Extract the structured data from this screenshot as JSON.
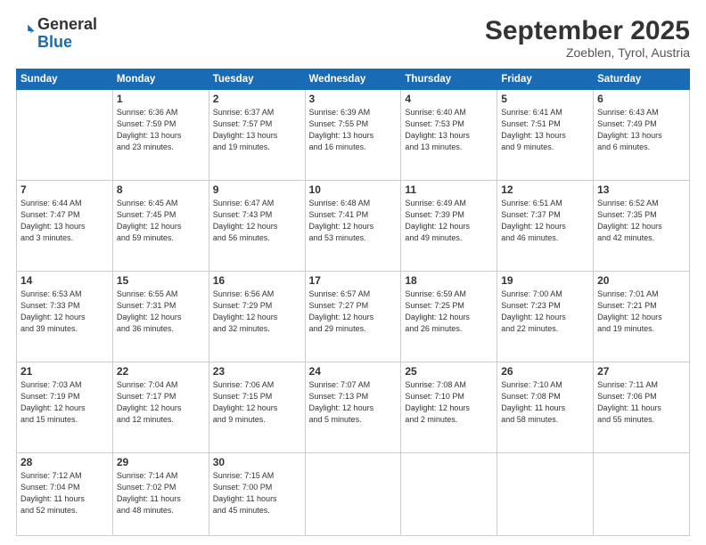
{
  "header": {
    "logo_general": "General",
    "logo_blue": "Blue",
    "month": "September 2025",
    "location": "Zoeblen, Tyrol, Austria"
  },
  "weekdays": [
    "Sunday",
    "Monday",
    "Tuesday",
    "Wednesday",
    "Thursday",
    "Friday",
    "Saturday"
  ],
  "weeks": [
    [
      {
        "day": "",
        "info": ""
      },
      {
        "day": "1",
        "info": "Sunrise: 6:36 AM\nSunset: 7:59 PM\nDaylight: 13 hours\nand 23 minutes."
      },
      {
        "day": "2",
        "info": "Sunrise: 6:37 AM\nSunset: 7:57 PM\nDaylight: 13 hours\nand 19 minutes."
      },
      {
        "day": "3",
        "info": "Sunrise: 6:39 AM\nSunset: 7:55 PM\nDaylight: 13 hours\nand 16 minutes."
      },
      {
        "day": "4",
        "info": "Sunrise: 6:40 AM\nSunset: 7:53 PM\nDaylight: 13 hours\nand 13 minutes."
      },
      {
        "day": "5",
        "info": "Sunrise: 6:41 AM\nSunset: 7:51 PM\nDaylight: 13 hours\nand 9 minutes."
      },
      {
        "day": "6",
        "info": "Sunrise: 6:43 AM\nSunset: 7:49 PM\nDaylight: 13 hours\nand 6 minutes."
      }
    ],
    [
      {
        "day": "7",
        "info": "Sunrise: 6:44 AM\nSunset: 7:47 PM\nDaylight: 13 hours\nand 3 minutes."
      },
      {
        "day": "8",
        "info": "Sunrise: 6:45 AM\nSunset: 7:45 PM\nDaylight: 12 hours\nand 59 minutes."
      },
      {
        "day": "9",
        "info": "Sunrise: 6:47 AM\nSunset: 7:43 PM\nDaylight: 12 hours\nand 56 minutes."
      },
      {
        "day": "10",
        "info": "Sunrise: 6:48 AM\nSunset: 7:41 PM\nDaylight: 12 hours\nand 53 minutes."
      },
      {
        "day": "11",
        "info": "Sunrise: 6:49 AM\nSunset: 7:39 PM\nDaylight: 12 hours\nand 49 minutes."
      },
      {
        "day": "12",
        "info": "Sunrise: 6:51 AM\nSunset: 7:37 PM\nDaylight: 12 hours\nand 46 minutes."
      },
      {
        "day": "13",
        "info": "Sunrise: 6:52 AM\nSunset: 7:35 PM\nDaylight: 12 hours\nand 42 minutes."
      }
    ],
    [
      {
        "day": "14",
        "info": "Sunrise: 6:53 AM\nSunset: 7:33 PM\nDaylight: 12 hours\nand 39 minutes."
      },
      {
        "day": "15",
        "info": "Sunrise: 6:55 AM\nSunset: 7:31 PM\nDaylight: 12 hours\nand 36 minutes."
      },
      {
        "day": "16",
        "info": "Sunrise: 6:56 AM\nSunset: 7:29 PM\nDaylight: 12 hours\nand 32 minutes."
      },
      {
        "day": "17",
        "info": "Sunrise: 6:57 AM\nSunset: 7:27 PM\nDaylight: 12 hours\nand 29 minutes."
      },
      {
        "day": "18",
        "info": "Sunrise: 6:59 AM\nSunset: 7:25 PM\nDaylight: 12 hours\nand 26 minutes."
      },
      {
        "day": "19",
        "info": "Sunrise: 7:00 AM\nSunset: 7:23 PM\nDaylight: 12 hours\nand 22 minutes."
      },
      {
        "day": "20",
        "info": "Sunrise: 7:01 AM\nSunset: 7:21 PM\nDaylight: 12 hours\nand 19 minutes."
      }
    ],
    [
      {
        "day": "21",
        "info": "Sunrise: 7:03 AM\nSunset: 7:19 PM\nDaylight: 12 hours\nand 15 minutes."
      },
      {
        "day": "22",
        "info": "Sunrise: 7:04 AM\nSunset: 7:17 PM\nDaylight: 12 hours\nand 12 minutes."
      },
      {
        "day": "23",
        "info": "Sunrise: 7:06 AM\nSunset: 7:15 PM\nDaylight: 12 hours\nand 9 minutes."
      },
      {
        "day": "24",
        "info": "Sunrise: 7:07 AM\nSunset: 7:13 PM\nDaylight: 12 hours\nand 5 minutes."
      },
      {
        "day": "25",
        "info": "Sunrise: 7:08 AM\nSunset: 7:10 PM\nDaylight: 12 hours\nand 2 minutes."
      },
      {
        "day": "26",
        "info": "Sunrise: 7:10 AM\nSunset: 7:08 PM\nDaylight: 11 hours\nand 58 minutes."
      },
      {
        "day": "27",
        "info": "Sunrise: 7:11 AM\nSunset: 7:06 PM\nDaylight: 11 hours\nand 55 minutes."
      }
    ],
    [
      {
        "day": "28",
        "info": "Sunrise: 7:12 AM\nSunset: 7:04 PM\nDaylight: 11 hours\nand 52 minutes."
      },
      {
        "day": "29",
        "info": "Sunrise: 7:14 AM\nSunset: 7:02 PM\nDaylight: 11 hours\nand 48 minutes."
      },
      {
        "day": "30",
        "info": "Sunrise: 7:15 AM\nSunset: 7:00 PM\nDaylight: 11 hours\nand 45 minutes."
      },
      {
        "day": "",
        "info": ""
      },
      {
        "day": "",
        "info": ""
      },
      {
        "day": "",
        "info": ""
      },
      {
        "day": "",
        "info": ""
      }
    ]
  ]
}
